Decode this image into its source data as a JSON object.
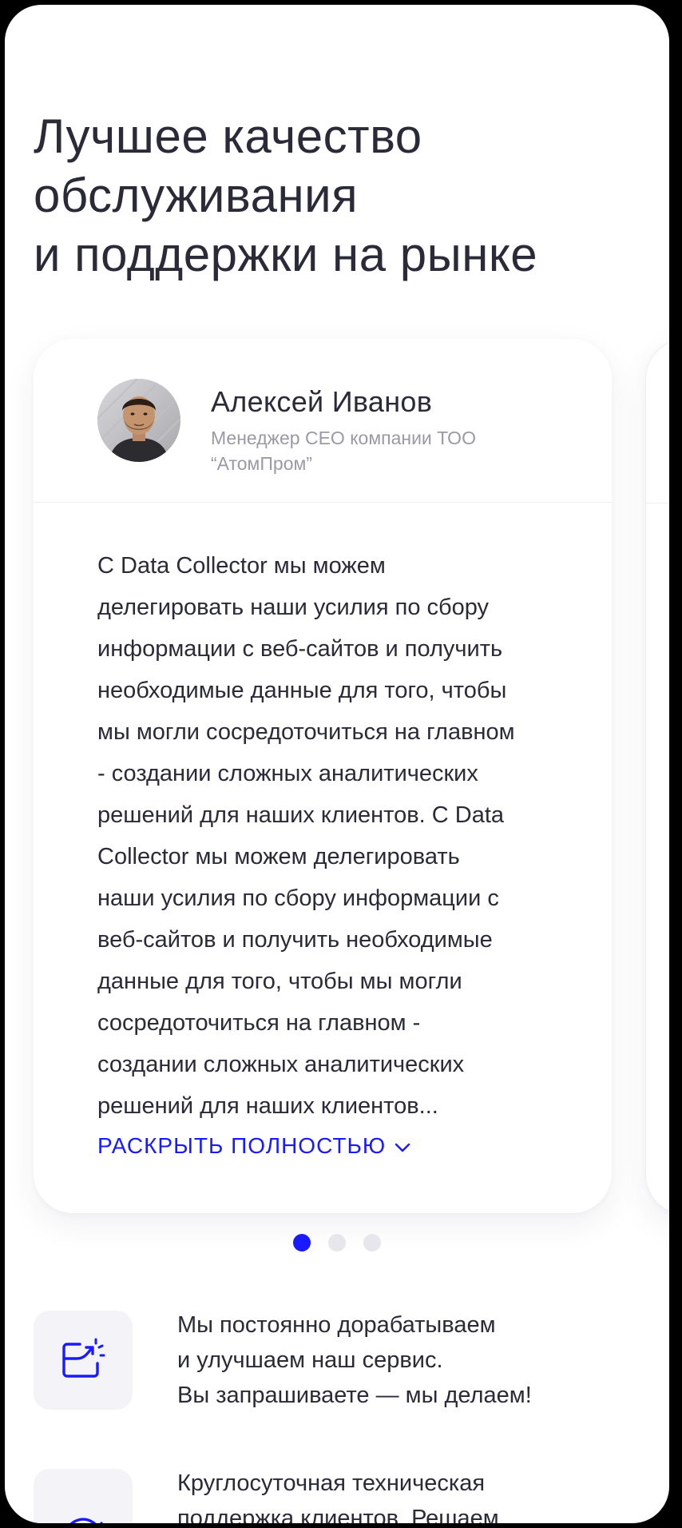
{
  "heading": {
    "line1": "Лучшее качество",
    "line2": "обслуживания",
    "line3": "и поддержки на рынке"
  },
  "testimonial": {
    "author_name": "Алексей Иванов",
    "author_role_line1": "Менеджер СЕО компании ТОО",
    "author_role_line2": "“АтомПром”",
    "review_lines": [
      "С Data Collector мы можем",
      "делегировать наши усилия по сбору",
      "информации с веб-сайтов и получить",
      "необходимые данные для того, чтобы",
      "мы могли сосредоточиться на главном",
      "- создании сложных аналитических",
      "решений для наших клиентов. С Data",
      "Collector мы можем делегировать",
      "наши усилия по сбору информации с",
      "веб-сайтов и получить необходимые",
      "данные для того, чтобы мы могли",
      "сосредоточиться на главном -",
      "создании сложных аналитических",
      "решений для наших клиентов..."
    ],
    "expand_label": "РАСКРЫТЬ ПОЛНОСТЬЮ"
  },
  "carousel": {
    "active_index": 1,
    "total": 3
  },
  "features": [
    {
      "icon": "improve-icon",
      "lines": [
        "Мы постоянно дорабатываем",
        "и улучшаем наш сервис.",
        "Вы запрашиваете — мы делаем!"
      ]
    },
    {
      "icon": "support-24-icon",
      "lines": [
        "Круглосуточная техническая",
        "поддержка клиентов. Решаем"
      ]
    }
  ],
  "colors": {
    "accent": "#1a1aff",
    "text": "#2a2a38",
    "muted": "#9a9aa6",
    "icon_bg": "#f3f3f8"
  }
}
